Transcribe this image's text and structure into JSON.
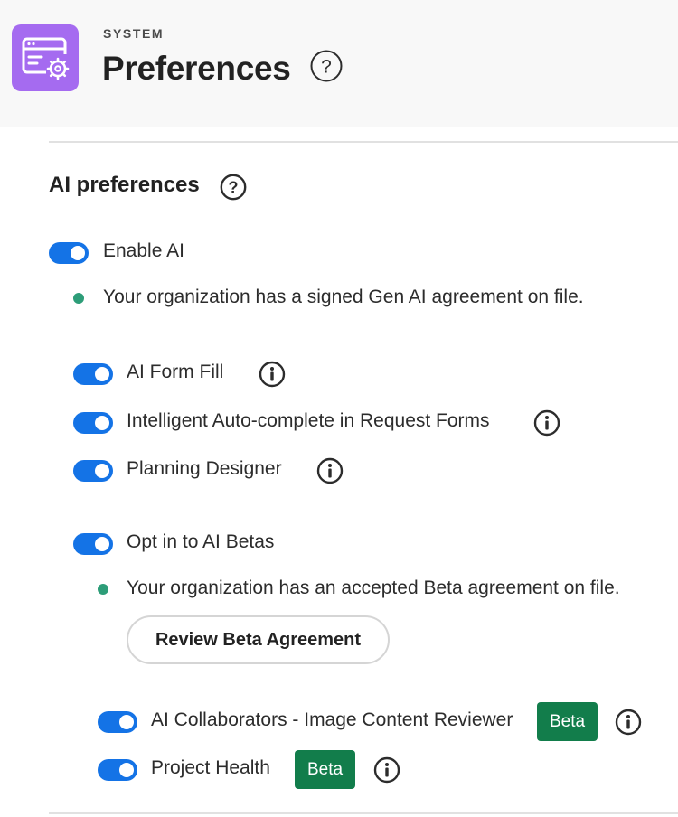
{
  "header": {
    "kicker": "SYSTEM",
    "title": "Preferences",
    "app_icon": "window-gear-icon",
    "help_icon": "help-icon"
  },
  "section": {
    "title": "AI preferences",
    "help_icon": "help-icon"
  },
  "enable_ai": {
    "label": "Enable AI",
    "on": true,
    "status_text": "Your organization has a signed Gen AI agreement on file.",
    "status_color": "#2d9d78"
  },
  "features": [
    {
      "label": "AI Form Fill",
      "on": true,
      "info_icon": "info-icon"
    },
    {
      "label": "Intelligent Auto-complete in Request Forms",
      "on": true,
      "info_icon": "info-icon"
    },
    {
      "label": "Planning Designer",
      "on": true,
      "info_icon": "info-icon"
    }
  ],
  "betas": {
    "label": "Opt in to AI Betas",
    "on": true,
    "status_text": "Your organization has an accepted Beta agreement on file.",
    "review_button": "Review Beta Agreement",
    "items": [
      {
        "label": "AI Collaborators - Image Content Reviewer",
        "on": true,
        "badge": "Beta",
        "info_icon": "info-icon"
      },
      {
        "label": "Project Health",
        "on": true,
        "badge": "Beta",
        "info_icon": "info-icon"
      }
    ]
  },
  "colors": {
    "toggle_on": "#1473e6",
    "beta_badge": "#127d4b",
    "app_icon_bg": "#a56bf0",
    "success_dot": "#2d9d78"
  }
}
